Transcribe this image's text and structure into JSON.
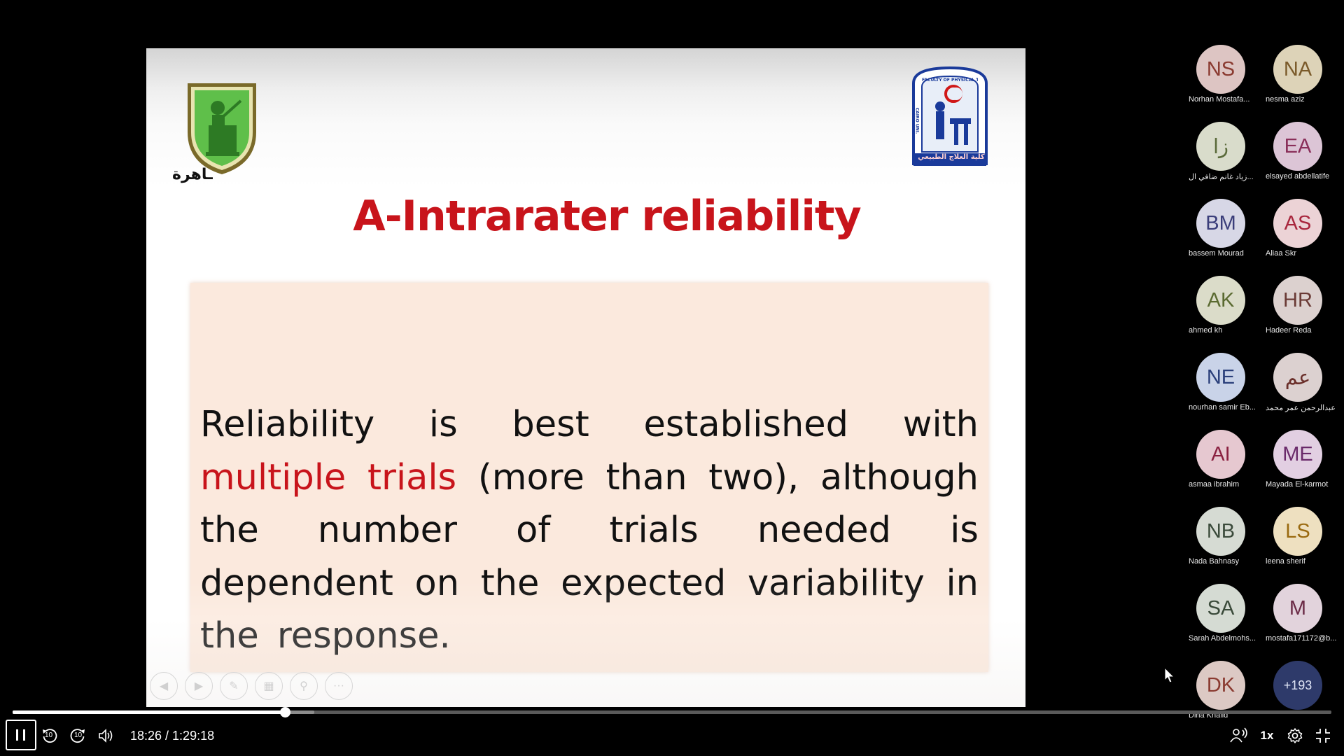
{
  "slide": {
    "title": "A-Intrarater reliability",
    "body_pre": "Reliability is best established with",
    "body_highlight": "multiple trials",
    "body_post": "(more than two), although the number of trials needed is dependent on the expected variability in the response.",
    "left_logo_text": "ـاهرة",
    "right_logo_text": "كلية العلاج الطبيعي",
    "right_logo_ring_text": "FACULTY OF PHYSICAL THERAPY",
    "right_logo_side_text": "CAIRO UNI."
  },
  "participants": [
    {
      "initials": "NS",
      "name": "Norhan Mostafa...",
      "bg": "#ddc5c3",
      "fg": "#8a3a30"
    },
    {
      "initials": "NA",
      "name": "nesma aziz",
      "bg": "#ddd3b8",
      "fg": "#7a5a2a"
    },
    {
      "initials": "زا",
      "name": "زياد غانم ضافي ال...",
      "bg": "#d9dccb",
      "fg": "#5a6a3a"
    },
    {
      "initials": "EA",
      "name": "elsayed abdellatife",
      "bg": "#dcc5d6",
      "fg": "#8a2f5a"
    },
    {
      "initials": "BM",
      "name": "bassem Mourad",
      "bg": "#d7d7e6",
      "fg": "#3a3d7a"
    },
    {
      "initials": "AS",
      "name": "Aliaa Skr",
      "bg": "#ecd3d6",
      "fg": "#a8253c"
    },
    {
      "initials": "AK",
      "name": "ahmed kh",
      "bg": "#dbdcc9",
      "fg": "#5a6a30"
    },
    {
      "initials": "HR",
      "name": "Hadeer Reda",
      "bg": "#dcd1cf",
      "fg": "#6a3a35"
    },
    {
      "initials": "NE",
      "name": "nourhan samir Eb...",
      "bg": "#c9d3e8",
      "fg": "#2a3f7a"
    },
    {
      "initials": "عم",
      "name": "عبدالرحمن عمر محمد",
      "bg": "#dcd1d0",
      "fg": "#6a2f2a"
    },
    {
      "initials": "AI",
      "name": "asmaa ibrahim",
      "bg": "#e6c8d0",
      "fg": "#8a2040"
    },
    {
      "initials": "ME",
      "name": "Mayada El-karmot",
      "bg": "#e2cfe2",
      "fg": "#6a2a6a"
    },
    {
      "initials": "NB",
      "name": "Nada Bahnasy",
      "bg": "#d6dbd3",
      "fg": "#3a4a3a"
    },
    {
      "initials": "LS",
      "name": "leena sherif",
      "bg": "#eee0c0",
      "fg": "#9a6a10"
    },
    {
      "initials": "SA",
      "name": "Sarah Abdelmohs...",
      "bg": "#d5dbd3",
      "fg": "#3a4a3a"
    },
    {
      "initials": "M",
      "name": "mostafa171172@b...",
      "bg": "#e2d3dc",
      "fg": "#6a2a45"
    },
    {
      "initials": "DK",
      "name": "Dina Khalid",
      "bg": "#dcc9c4",
      "fg": "#8a3a30"
    },
    {
      "initials": "+193",
      "name": "",
      "bg": "#2e3a6a",
      "fg": "#dfe4f5"
    }
  ],
  "player": {
    "current_time": "18:26",
    "total_time": "1:29:18",
    "time_display": "18:26 / 1:29:18",
    "progress_fraction": 0.2063,
    "buffered_fraction": 0.229,
    "speed_label": "1x",
    "rewind_seconds": "10",
    "forward_seconds": "10"
  },
  "icons": {
    "pause": "pause-icon",
    "rewind": "rewind-10-icon",
    "forward": "forward-10-icon",
    "volume": "volume-icon",
    "captions": "captions-icon",
    "settings": "gear-icon",
    "fullscreen": "exit-fullscreen-icon"
  }
}
